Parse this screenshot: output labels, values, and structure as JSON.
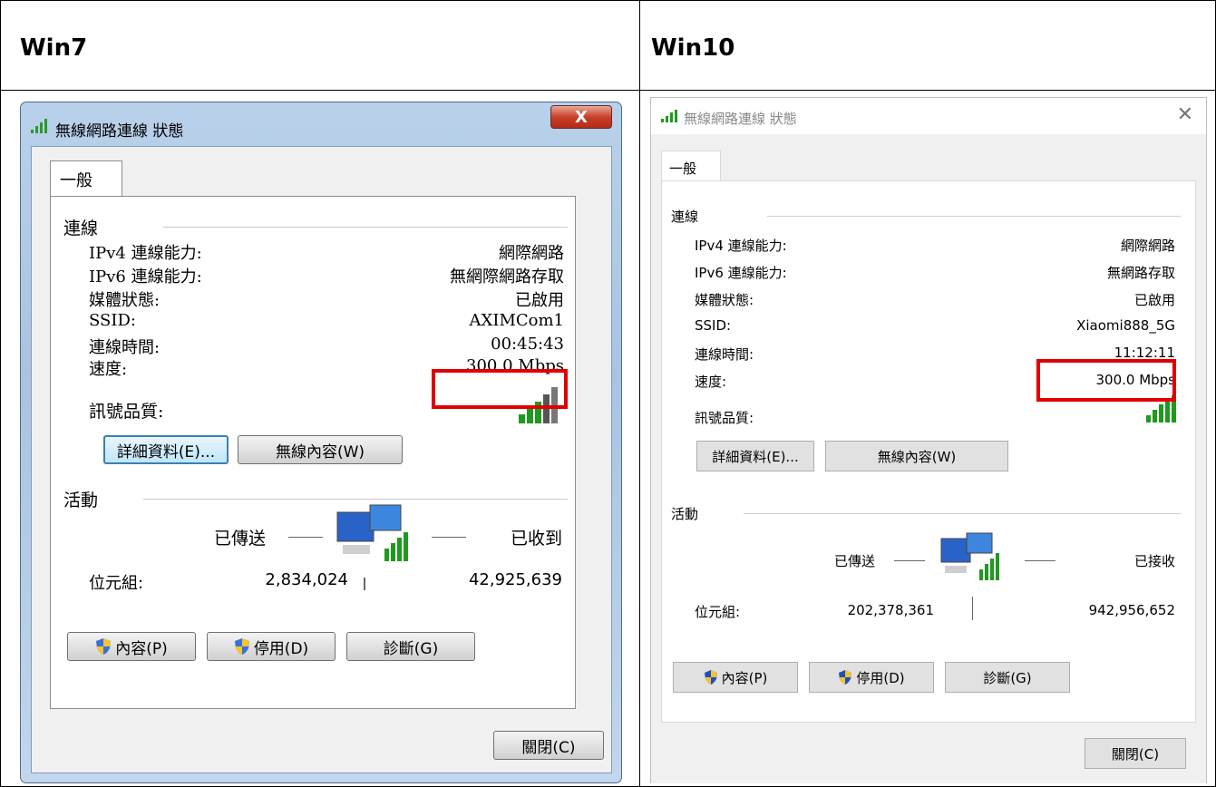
{
  "headers": {
    "left": "Win7",
    "right": "Win10"
  },
  "win7": {
    "title": "無線網路連線 狀態",
    "close_label": "X",
    "tab": "一般",
    "connection_section": "連線",
    "rows": [
      {
        "label": "IPv4 連線能力:",
        "value": "網際網路"
      },
      {
        "label": "IPv6 連線能力:",
        "value": "無網際網路存取"
      },
      {
        "label": "媒體狀態:",
        "value": "已啟用"
      },
      {
        "label": "SSID:",
        "value": "AXIMCom1"
      },
      {
        "label": "連線時間:",
        "value": "00:45:43"
      },
      {
        "label": "速度:",
        "value": "300.0 Mbps"
      }
    ],
    "signal_label": "訊號品質:",
    "details_button": "詳細資料(E)...",
    "wireless_button": "無線內容(W)",
    "activity_section": "活動",
    "sent_label": "已傳送",
    "received_label": "已收到",
    "bytes_label": "位元組:",
    "bytes_sent": "2,834,024",
    "bytes_received": "42,925,639",
    "properties_button": "內容(P)",
    "disable_button": "停用(D)",
    "diagnose_button": "診斷(G)",
    "close_button": "關閉(C)"
  },
  "win10": {
    "title": "無線網路連線 狀態",
    "tab": "一般",
    "connection_section": "連線",
    "rows": [
      {
        "label": "IPv4 連線能力:",
        "value": "網際網路"
      },
      {
        "label": "IPv6 連線能力:",
        "value": "無網路存取"
      },
      {
        "label": "媒體狀態:",
        "value": "已啟用"
      },
      {
        "label": "SSID:",
        "value": "Xiaomi888_5G"
      },
      {
        "label": "連線時間:",
        "value": "11:12:11"
      },
      {
        "label": "速度:",
        "value": "300.0 Mbps"
      }
    ],
    "signal_label": "訊號品質:",
    "details_button": "詳細資料(E)...",
    "wireless_button": "無線內容(W)",
    "activity_section": "活動",
    "sent_label": "已傳送",
    "received_label": "已接收",
    "bytes_label": "位元組:",
    "bytes_sent": "202,378,361",
    "bytes_received": "942,956,652",
    "properties_button": "內容(P)",
    "disable_button": "停用(D)",
    "diagnose_button": "診斷(G)",
    "close_button": "關閉(C)"
  },
  "colors": {
    "highlight": "#e00000",
    "signal_green": "#1f9a1f"
  }
}
